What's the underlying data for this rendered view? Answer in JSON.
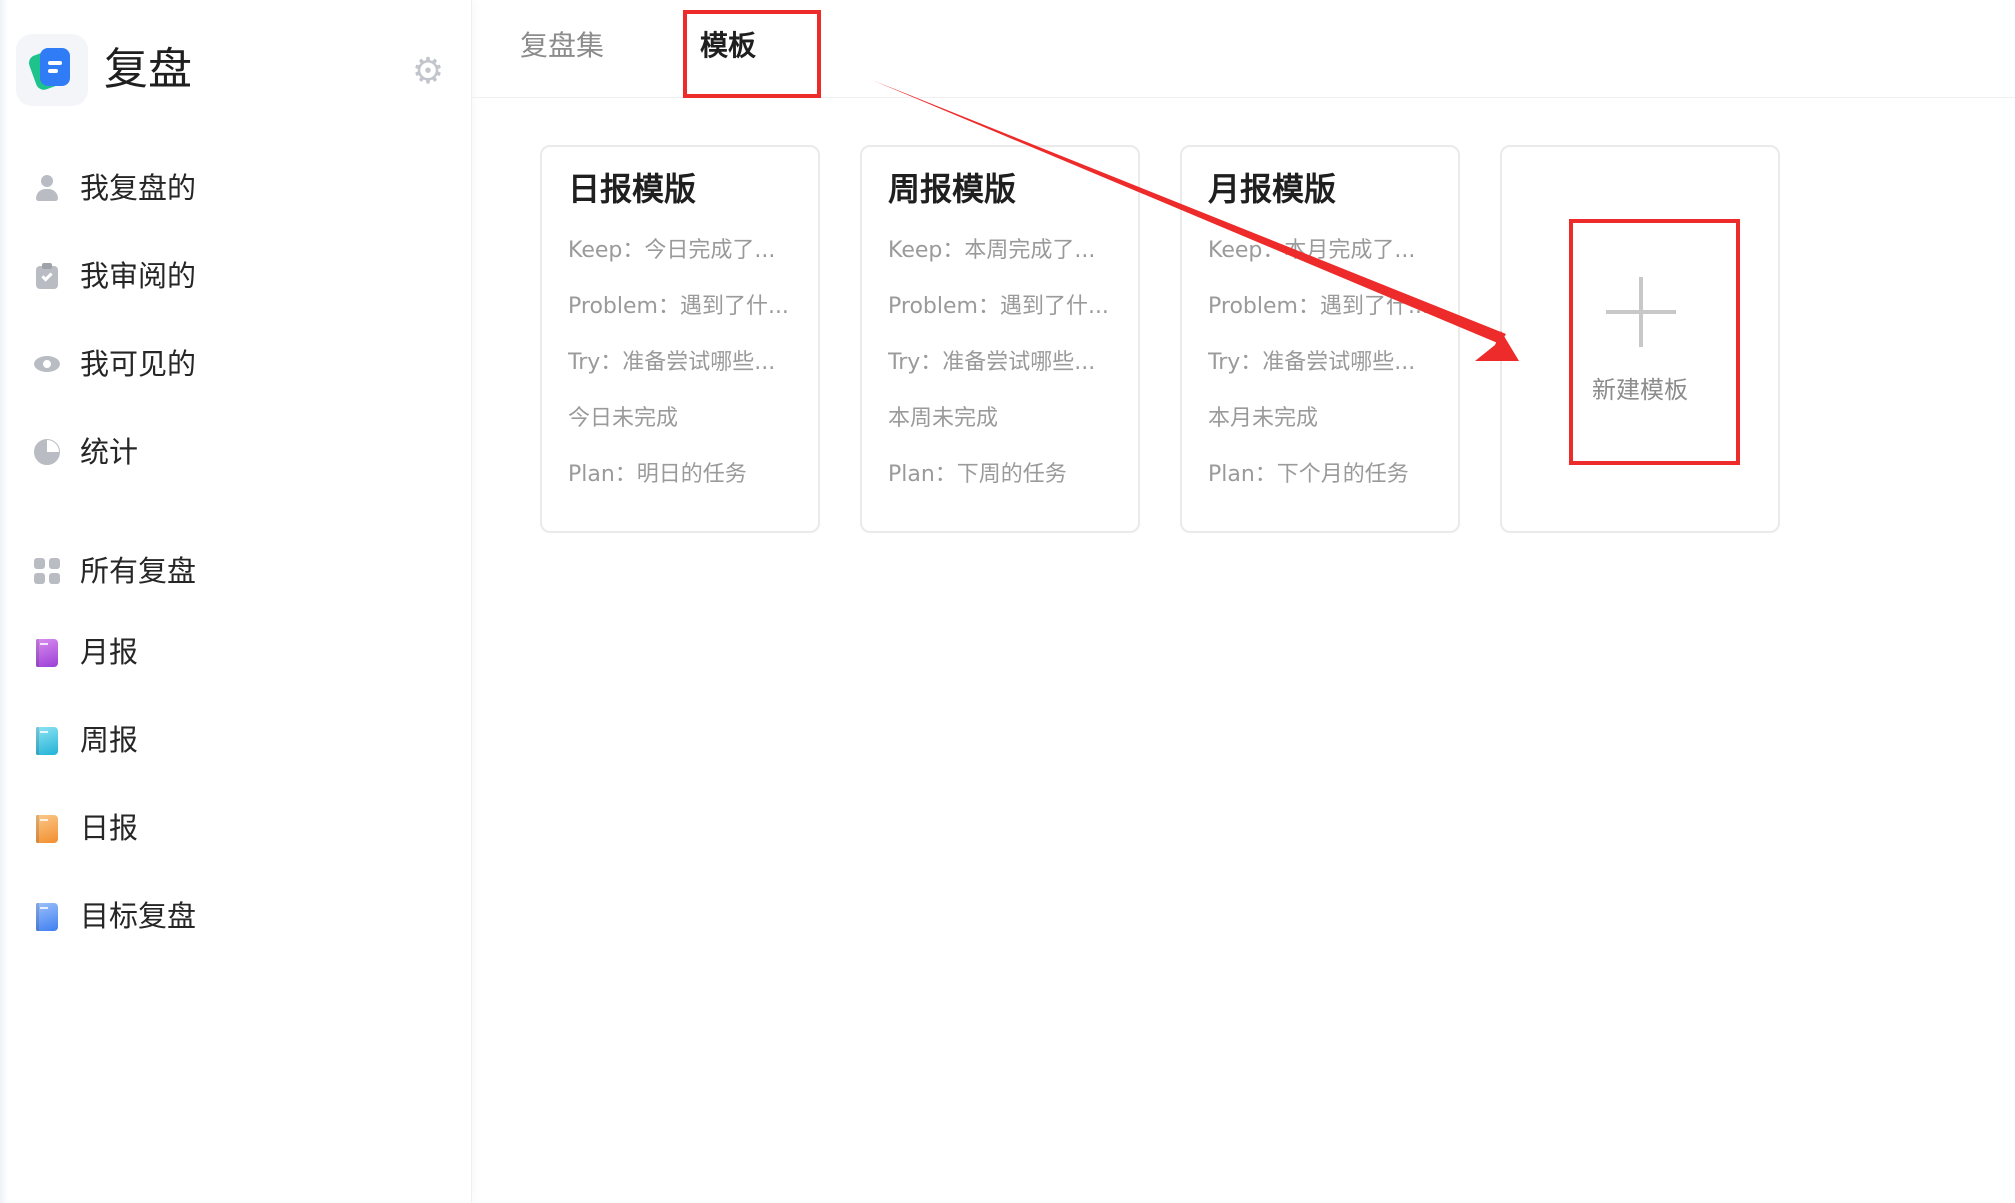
{
  "app": {
    "title": "复盘"
  },
  "sidebar": {
    "main_items": [
      {
        "label": "我复盘的",
        "icon": "person-icon"
      },
      {
        "label": "我审阅的",
        "icon": "clipboard-check-icon"
      },
      {
        "label": "我可见的",
        "icon": "eye-icon"
      },
      {
        "label": "统计",
        "icon": "pie-chart-icon"
      }
    ],
    "collection_items": [
      {
        "label": "所有复盘",
        "icon": "grid-icon"
      },
      {
        "label": "月报",
        "icon": "purple-book-icon",
        "color": "#b34bdc"
      },
      {
        "label": "周报",
        "icon": "cyan-book-icon",
        "color": "#32c6e6"
      },
      {
        "label": "日报",
        "icon": "orange-book-icon",
        "color": "#f7a24a"
      },
      {
        "label": "目标复盘",
        "icon": "blue-book-icon",
        "color": "#4f8ef5"
      }
    ]
  },
  "tabs": [
    {
      "label": "复盘集",
      "active": false
    },
    {
      "label": "模板",
      "active": true
    }
  ],
  "templates": [
    {
      "title": "日报模版",
      "lines": [
        "Keep：今日完成了...",
        "Problem：遇到了什...",
        "Try：准备尝试哪些...",
        "今日未完成",
        "Plan：明日的任务"
      ]
    },
    {
      "title": "周报模版",
      "lines": [
        "Keep：本周完成了...",
        "Problem：遇到了什...",
        "Try：准备尝试哪些...",
        "本周未完成",
        "Plan：下周的任务"
      ]
    },
    {
      "title": "月报模版",
      "lines": [
        "Keep：本月完成了...",
        "Problem：遇到了什...",
        "Try：准备尝试哪些...",
        "本月未完成",
        "Plan：下个月的任务"
      ]
    }
  ],
  "new_template": {
    "label": "新建模板",
    "icon": "plus-icon"
  },
  "annotation": {
    "color": "#ee2b2b"
  }
}
